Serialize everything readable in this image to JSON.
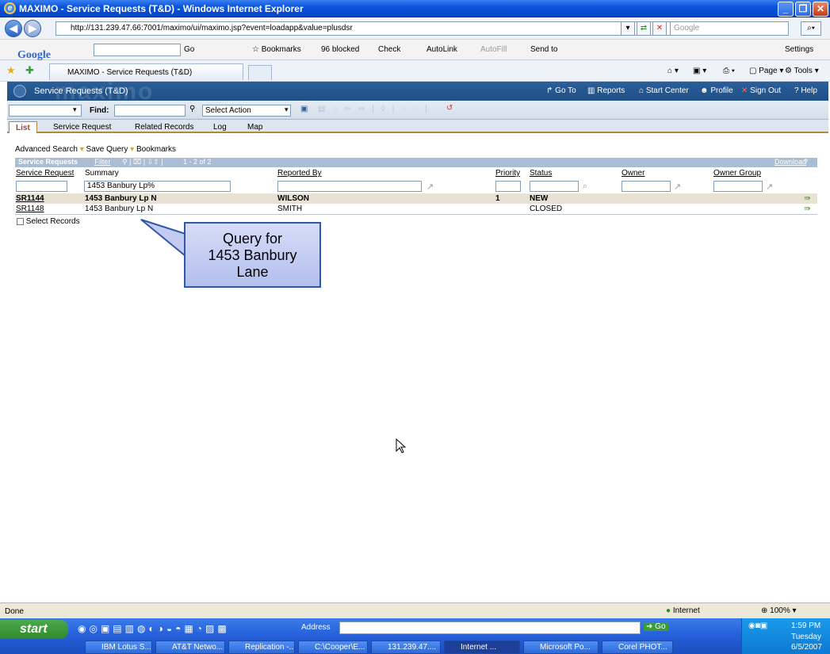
{
  "window": {
    "title": "MAXIMO - Service Requests (T&D) - Windows Internet Explorer"
  },
  "addressbar": {
    "url": "http://131.239.47.66:7001/maximo/ui/maximo.jsp?event=loadapp&value=plusdsr",
    "search_placeholder": "Google"
  },
  "googlebar": {
    "logo": "Google",
    "go": "Go",
    "bookmarks": "Bookmarks",
    "blocked": "96 blocked",
    "check": "Check",
    "autolink": "AutoLink",
    "autofill": "AutoFill",
    "sendto": "Send to",
    "settings": "Settings"
  },
  "browsertabs": {
    "active": "MAXIMO - Service Requests (T&D)",
    "page": "Page",
    "tools": "Tools"
  },
  "maximo": {
    "app_title": "Service Requests (T&D)",
    "watermark": "maximo",
    "links": [
      "Go To",
      "Reports",
      "Start Center",
      "Profile",
      "Sign Out",
      "? Help"
    ]
  },
  "toolbar": {
    "find_label": "Find:",
    "select_action": "Select Action"
  },
  "tabs": [
    "List",
    "Service Request",
    "Related Records",
    "Log",
    "Map"
  ],
  "subbar": {
    "advanced_search": "Advanced Search",
    "save_query": "Save Query",
    "bookmarks": "Bookmarks"
  },
  "table": {
    "title": "Service Requests",
    "filter": "Filter",
    "count": "1 - 2 of 2",
    "download": "Download",
    "columns": [
      "Service Request",
      "Summary",
      "Reported By",
      "Priority",
      "Status",
      "Owner",
      "Owner Group"
    ],
    "filter_summary": "1453 Banbury Lp%",
    "rows": [
      {
        "sr": "SR1144",
        "summary": "1453 Banbury Lp N",
        "reported_by": "WILSON",
        "priority": "1",
        "status": "NEW"
      },
      {
        "sr": "SR1148",
        "summary": "1453 Banbury Lp N",
        "reported_by": "SMITH",
        "priority": "",
        "status": "CLOSED"
      }
    ],
    "select_records": "Select Records"
  },
  "callout": {
    "line1": "Query for",
    "line2": "1453 Banbury",
    "line3": "Lane"
  },
  "statusbar": {
    "left": "Done",
    "zone": "Internet",
    "zoom": "100%"
  },
  "taskbar": {
    "start": "start",
    "address_label": "Address",
    "go": "Go",
    "tasks": [
      "IBM Lotus S...",
      "AT&T Netwo...",
      "Replication -...",
      "C:\\Cooper\\E...",
      "131.239.47....",
      "Internet ...",
      "Microsoft Po...",
      "Corel PHOT..."
    ],
    "time": "1:59 PM",
    "day": "Tuesday",
    "date": "6/5/2007"
  }
}
